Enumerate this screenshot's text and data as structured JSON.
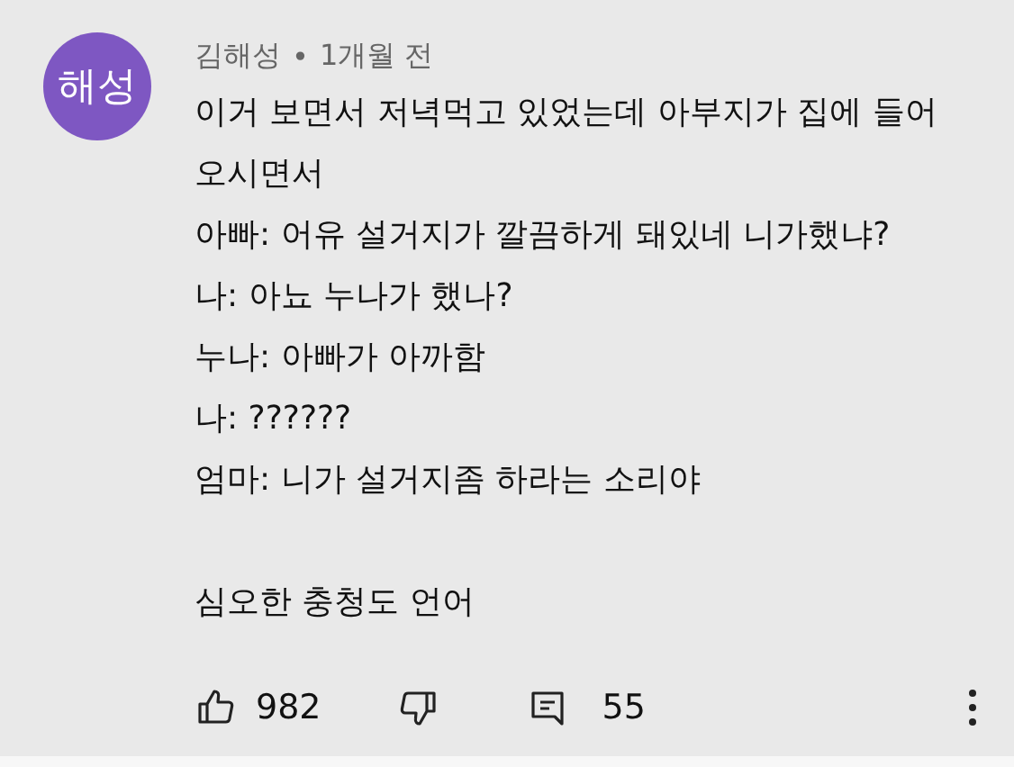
{
  "comment": {
    "avatar_text": "해성",
    "author": "김해성",
    "separator": "•",
    "time": "1개월 전",
    "paragraphs": [
      {
        "lines": [
          "이거 보면서 저녁먹고 있었는데 아부지가 집에 들어 오시면서",
          "아빠: 어유 설거지가 깔끔하게 돼있네 니가했냐?",
          "나: 아뇨 누나가 했나?",
          "누나: 아빠가 아까함",
          "나: ??????",
          "엄마: 니가 설거지좀 하라는 소리야"
        ]
      },
      {
        "lines": [
          "심오한 충청도 언어"
        ]
      }
    ],
    "likes": "982",
    "replies": "55"
  }
}
